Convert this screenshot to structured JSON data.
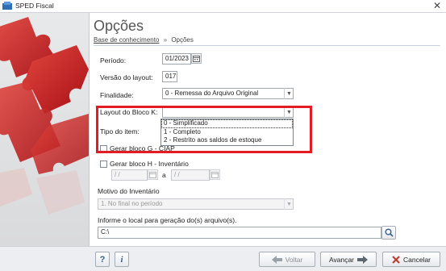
{
  "window": {
    "title": "SPED Fiscal"
  },
  "header": {
    "title": "Opções",
    "breadcrumb": {
      "link": "Base de conhecimento",
      "separator": "»",
      "current": "Opções"
    }
  },
  "form": {
    "periodo": {
      "label": "Período:",
      "value": "01/2023"
    },
    "versao": {
      "label": "Versão do layout:",
      "value": "017"
    },
    "finalidade": {
      "label": "Finalidade:",
      "value": "0 - Remessa do Arquivo Original"
    },
    "layout_bloco_k": {
      "label": "Layout do Bloco K:",
      "value": "",
      "options": [
        "0 - Simplificado",
        "1 - Completo",
        "2 - Restrito aos saldos de estoque"
      ]
    },
    "tipo_item": {
      "label": "Tipo do item:"
    },
    "gerar_bloco_g": {
      "label": "Gerar bloco G - CIAP",
      "checked": false
    },
    "gerar_bloco_h": {
      "label": "Gerar bloco H - Inventário",
      "checked": false
    },
    "inventario_de": {
      "placeholder": " / / "
    },
    "inventario_sep": "a",
    "inventario_ate": {
      "placeholder": " / / "
    },
    "motivo": {
      "label": "Motivo do Inventário",
      "value": "1. No final no período"
    },
    "local": {
      "label": "Informe o local para geração do(s) arquivo(s).",
      "value": "C:\\"
    }
  },
  "footer": {
    "help_icon": "?",
    "info_icon": "i",
    "voltar": "Voltar",
    "avancar": "Avançar",
    "cancelar": "Cancelar"
  },
  "colors": {
    "highlight": "#e31b23",
    "puzzle": "#c4161c"
  }
}
